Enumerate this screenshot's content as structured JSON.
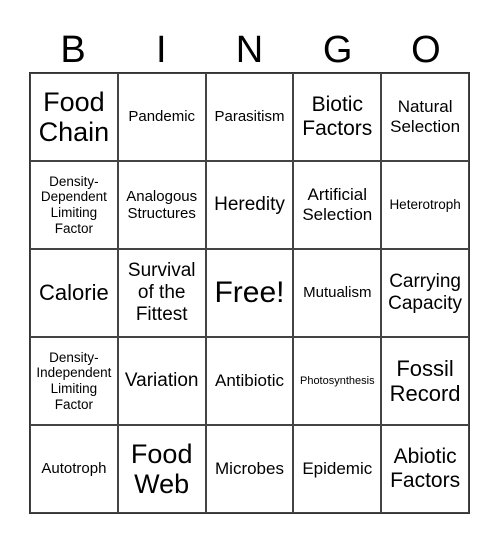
{
  "header": {
    "letters": [
      "B",
      "I",
      "N",
      "G",
      "O"
    ]
  },
  "cells": [
    "Food Chain",
    "Pandemic",
    "Parasitism",
    "Biotic Factors",
    "Natural Selection",
    "Density-Dependent Limiting Factor",
    "Analogous Structures",
    "Heredity",
    "Artificial Selection",
    "Heterotroph",
    "Calorie",
    "Survival of the Fittest",
    "Free!",
    "Mutualism",
    "Carrying Capacity",
    "Density-Independent Limiting Factor",
    "Variation",
    "Antibiotic",
    "Photosynthesis",
    "Fossil Record",
    "Autotroph",
    "Food Web",
    "Microbes",
    "Epidemic",
    "Abiotic Factors"
  ]
}
